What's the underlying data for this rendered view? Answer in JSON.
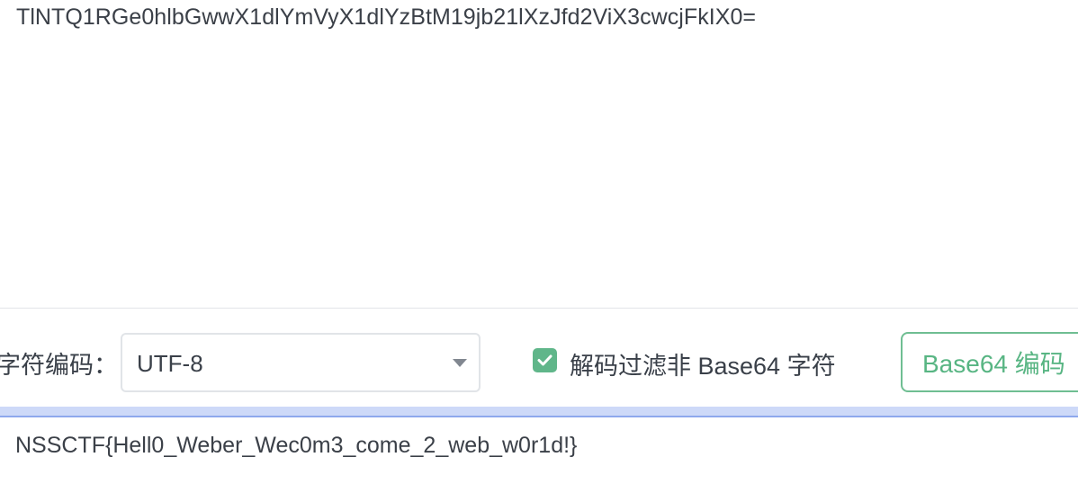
{
  "input": {
    "text": "TlNTQ1RGe0hlbGwwX1dlYmVyX1dlYzBtM19jb21lXzJfd2ViX3cwcjFkIX0="
  },
  "controls": {
    "charset_label": "字符编码：",
    "charset_value": "UTF-8",
    "filter_label": "解码过滤非 Base64 字符",
    "filter_checked": true,
    "encode_button_label": "Base64 编码"
  },
  "output": {
    "text": "NSSCTF{Hell0_Weber_Wec0m3_come_2_web_w0r1d!}"
  },
  "icons": {
    "dropdown": "chevron-down-icon",
    "checkbox": "check-icon"
  },
  "colors": {
    "accent_green": "#60b68a",
    "focus_blue": "#8ea8ed",
    "text": "#3a4049"
  }
}
